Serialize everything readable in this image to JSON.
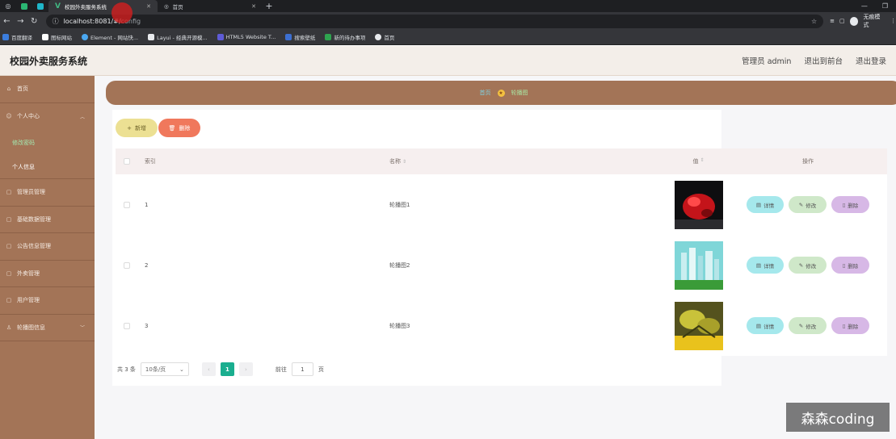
{
  "browser": {
    "active_tab": "校园外卖服务系统",
    "second_tab": "首页",
    "url_host": "localhost:8081/#/",
    "url_path": "config",
    "guest_label": "无痕模式",
    "bookmarks": [
      "百度翻译",
      "图标网站",
      "Element - 网站快...",
      "Layui - 经典开源模...",
      "HTML5 Website T...",
      "搜索壁纸",
      "新的待办事项",
      "首页"
    ]
  },
  "header": {
    "title": "校园外卖服务系统",
    "admin": "管理员 admin",
    "frontend": "退出到前台",
    "logout": "退出登录"
  },
  "sidebar": {
    "home": "首页",
    "personal": "个人中心",
    "change_password": "修改密码",
    "personal_info": "个人信息",
    "admin_mgmt": "管理员管理",
    "basic_data": "基础数据管理",
    "notice_mgmt": "公告信息管理",
    "takeout_mgmt": "外卖管理",
    "user_mgmt": "用户管理",
    "carousel_info": "轮播图信息"
  },
  "breadcrumb": {
    "home": "首页",
    "current": "轮播图"
  },
  "toolbar": {
    "add": "新增",
    "delete": "删除"
  },
  "table": {
    "headers": {
      "index": "索引",
      "name": "名称",
      "value": "值",
      "ops": "操作"
    },
    "rows": [
      {
        "index": "1",
        "name": "轮播图1",
        "image": "red-abstract"
      },
      {
        "index": "2",
        "name": "轮播图2",
        "image": "city-buildings"
      },
      {
        "index": "3",
        "name": "轮播图3",
        "image": "yellow-leaves"
      }
    ],
    "ops": {
      "detail": "详情",
      "edit": "修改",
      "delete": "删除"
    }
  },
  "pager": {
    "total": "共 3 条",
    "page_size": "10条/页",
    "current_page": "1",
    "goto_label": "前往",
    "goto_value": "1",
    "page_suffix": "页"
  },
  "watermark": "森森coding",
  "colors": {
    "sidebar_bg": "#a37457",
    "accent_green": "#1aae8f",
    "delete_orange": "#f0785c"
  }
}
